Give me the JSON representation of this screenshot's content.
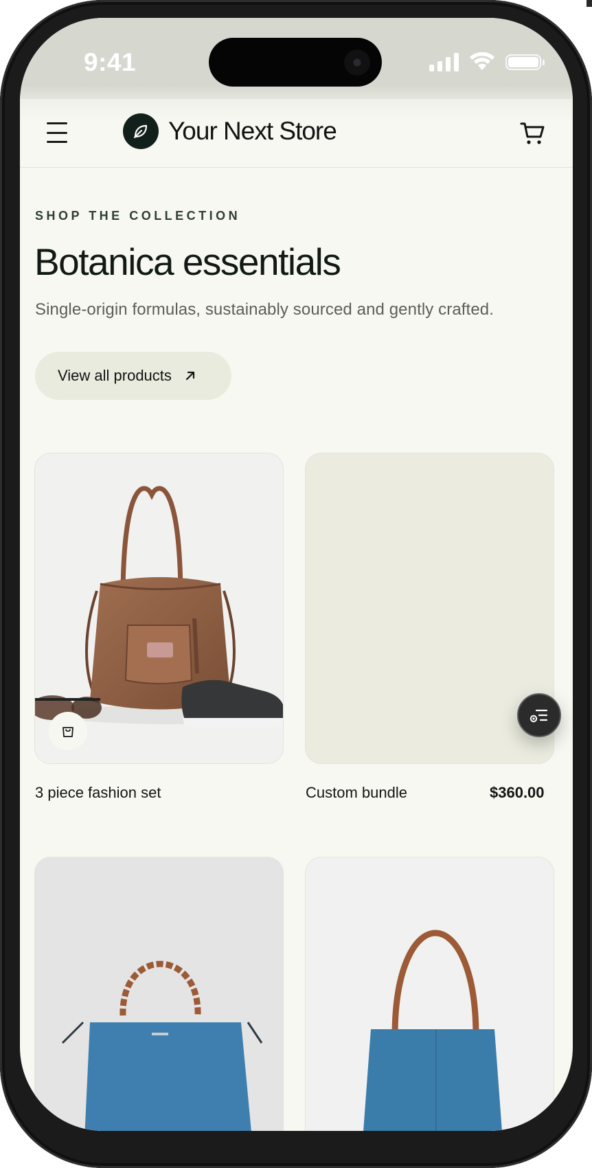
{
  "status_bar": {
    "time": "9:41"
  },
  "header": {
    "store_name": "Your Next Store",
    "icons": {
      "menu": "menu-icon",
      "logo": "leaf-icon",
      "cart": "cart-icon"
    }
  },
  "hero": {
    "eyebrow": "SHOP THE COLLECTION",
    "title": "Botanica essentials",
    "subtitle": "Single-origin formulas, sustainably sourced and gently crafted.",
    "cta_label": "View all products",
    "cta_icon": "arrow-up-right-icon"
  },
  "products": [
    {
      "name": "3 piece fashion set",
      "price": "",
      "image": "tote bag with sunglasses and sneakers"
    },
    {
      "name": "Custom bundle",
      "price": "$360.00",
      "image": ""
    },
    {
      "name": "",
      "price": "",
      "image": "blue handbag with woven handle"
    },
    {
      "name": "",
      "price": "",
      "image": "blue tote bag"
    }
  ],
  "floating_action": {
    "icon": "filter-list-icon"
  },
  "colors": {
    "page_background": "#f8f8f2",
    "logo_background": "#11201a",
    "cta_background": "#e9ebde",
    "eyebrow_text": "#2f3d33",
    "status_bar_background": "#d6d8d0"
  }
}
